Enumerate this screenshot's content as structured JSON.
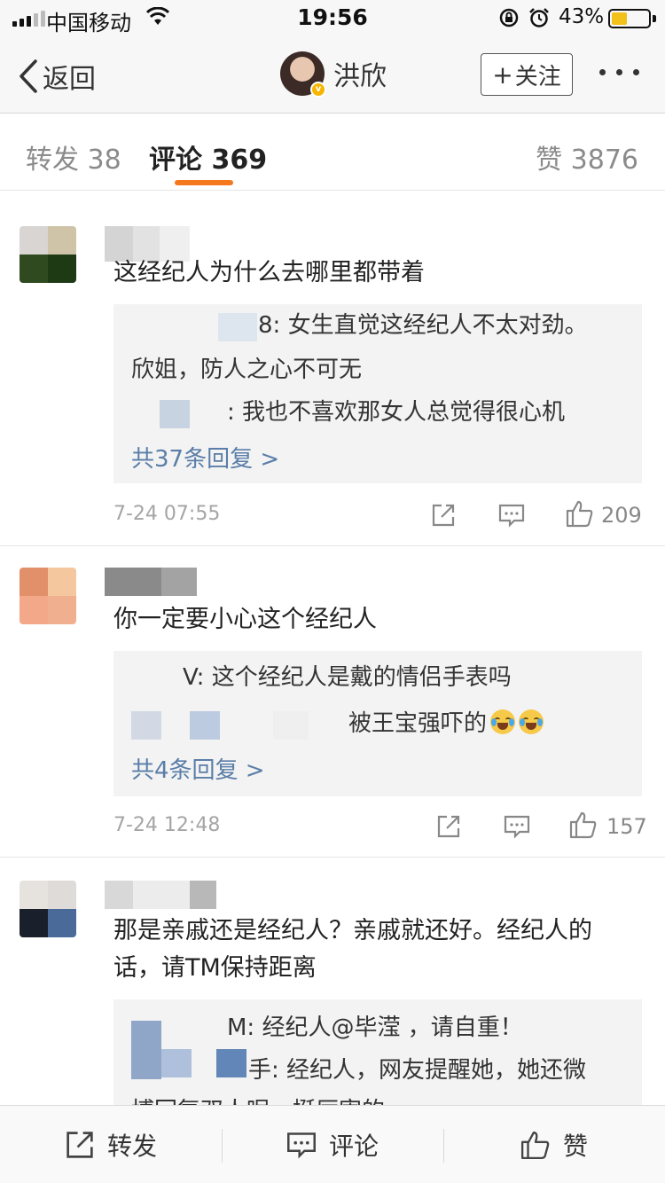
{
  "status_bar": {
    "carrier": "中国移动",
    "time": "19:56",
    "battery_text": "43%",
    "battery_level": 0.43,
    "icons": [
      "signal-icon",
      "wifi-icon",
      "rotation-lock-icon",
      "alarm-icon",
      "battery-icon"
    ]
  },
  "nav": {
    "back_label": "返回",
    "username": "洪欣",
    "follow_label": "关注",
    "follow_icon": "plus-icon",
    "more_icon": "more-dots-icon"
  },
  "tabs": {
    "repost": "转发 38",
    "comment": "评论 369",
    "like": "赞 3876",
    "accent_color": "#f5781f"
  },
  "comments": [
    {
      "text": "这经纪人为什么去哪里都带着",
      "replies": [
        "8: 女生直觉这经纪人不太对劲。",
        "欣姐，防人之心不可无",
        ": 我也不喜欢那女人总觉得很心机"
      ],
      "more_replies": "共37条回复 >",
      "time": "7-24 07:55",
      "like_count": "209"
    },
    {
      "text": "你一定要小心这个经纪人",
      "replies": [
        "V: 这个经纪人是戴的情侣手表吗",
        "被王宝强吓的"
      ],
      "more_replies": "共4条回复 >",
      "time": "7-24 12:48",
      "like_count": "157"
    },
    {
      "text": "那是亲戚还是经纪人？亲戚就还好。经纪人的话，请TM保持距离",
      "replies": [
        "M: 经纪人@毕滢 ，请自重！",
        "手: 经纪人，网友提醒她，她还微",
        "博回复双人呢，挺厉害的"
      ]
    }
  ],
  "bottom_bar": {
    "repost": "转发",
    "comment": "评论",
    "like": "赞"
  },
  "colors": {
    "link_blue": "#5a7ea8",
    "reply_bg": "#f3f3f3",
    "bar_bg": "#f7f7f7"
  }
}
